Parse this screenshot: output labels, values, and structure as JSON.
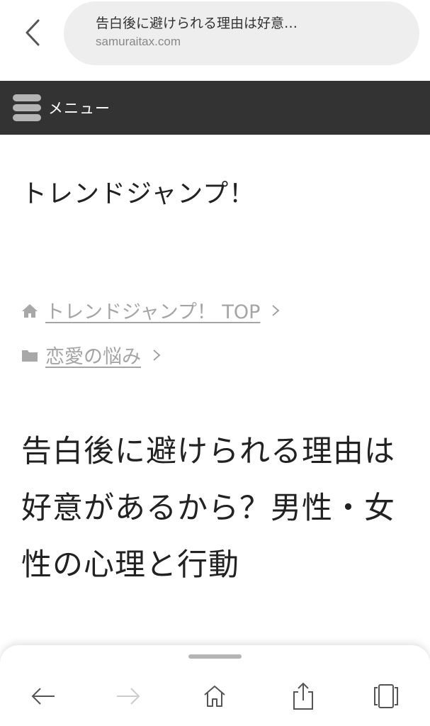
{
  "browser": {
    "page_title": "告白後に避けられる理由は好意…",
    "domain": "samuraitax.com"
  },
  "menu": {
    "label": "メニュー"
  },
  "site": {
    "title": "トレンドジャンプ！"
  },
  "breadcrumb": [
    {
      "label": "トレンドジャンプ！ TOP",
      "icon": "home-icon"
    },
    {
      "label": "恋愛の悩み",
      "icon": "folder-icon"
    }
  ],
  "article": {
    "title": "告白後に避けられる理由は好意があるから？男性・女性の心理と行動"
  },
  "toolbar": {
    "items": [
      "back-arrow-icon",
      "forward-arrow-icon",
      "home-icon",
      "share-icon",
      "tabs-icon"
    ]
  },
  "colors": {
    "menubar_bg": "#333333",
    "urlbar_bg": "#eeeeee",
    "link_gray": "#a5a5a5"
  }
}
